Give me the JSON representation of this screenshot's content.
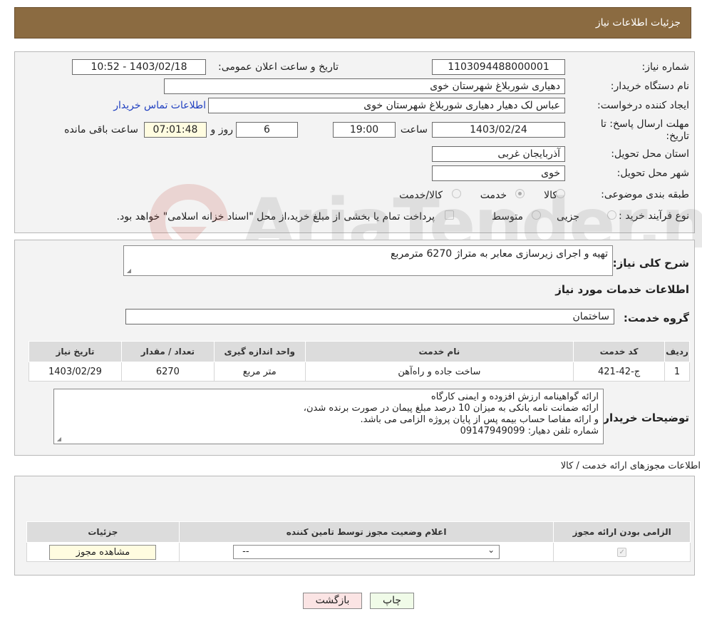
{
  "header": {
    "title": "جزئیات اطلاعات نیاز"
  },
  "info": {
    "need_number_label": "شماره نیاز:",
    "need_number": "1103094488000001",
    "announce_label": "تاریخ و ساعت اعلان عمومی:",
    "announce_value": "1403/02/18 - 10:52",
    "buyer_label": "نام دستگاه خریدار:",
    "buyer_value": "دهیاری شوربلاغ شهرستان خوی",
    "creator_label": "ایجاد کننده درخواست:",
    "creator_value": "عباس لک دهیار دهیاری شوربلاغ شهرستان خوی",
    "contact_link": "اطلاعات تماس خریدار",
    "deadline_label_1": "مهلت ارسال پاسخ: تا",
    "deadline_label_2": "تاریخ:",
    "deadline_date": "1403/02/24",
    "time_label": "ساعت",
    "deadline_time": "19:00",
    "days_value": "6",
    "days_label": "روز و",
    "remaining_time": "07:01:48",
    "remaining_label": "ساعت باقی مانده",
    "province_label": "استان محل تحویل:",
    "province_value": "آذربایجان غربی",
    "city_label": "شهر محل تحویل:",
    "city_value": "خوی",
    "category_label": "طبقه بندی موضوعی:",
    "category_options": [
      "کالا",
      "خدمت",
      "کالا/خدمت"
    ],
    "purchase_label": "نوع فرآیند خرید :",
    "purchase_options": [
      "جزیی",
      "متوسط"
    ],
    "payment_note": "پرداخت تمام یا بخشی از مبلغ خرید،از محل \"اسناد خزانه اسلامی\" خواهد بود."
  },
  "summary": {
    "desc_label": "شرح کلی نیاز:",
    "desc_value": "تهیه و اجرای زیرسازی معابر به متراژ 6270 مترمربع",
    "services_title": "اطلاعات خدمات مورد نیاز",
    "group_label": "گروه خدمت:",
    "group_value": "ساختمان",
    "table_headers": [
      "ردیف",
      "کد خدمت",
      "نام خدمت",
      "واحد اندازه گیری",
      "تعداد / مقدار",
      "تاریخ نیاز"
    ],
    "table_rows": [
      [
        "1",
        "ج-42-421",
        "ساخت جاده و راه‌آهن",
        "متر مربع",
        "6270",
        "1403/02/29"
      ]
    ],
    "buyer_notes_label": "توضیحات خریدار:",
    "buyer_notes": [
      "ارائه گواهینامه ارزش افزوده و ایمنی کارگاه",
      "ارائه ضمانت نامه بانکی به میزان 10 درصد مبلغ پیمان در صورت برنده شدن،",
      "و ارائه مفاصا حساب بیمه پس از پایان پروژه الزامی می باشد.",
      "شماره تلفن دهیار: 09147949099"
    ]
  },
  "permits": {
    "section_title": "اطلاعات مجوزهای ارائه خدمت / کالا",
    "headers": [
      "الزامی بودن ارائه مجوز",
      "اعلام وضعیت مجوز توسط تامین کننده",
      "جزئیات"
    ],
    "status_select": "--",
    "view_button": "مشاهده مجوز"
  },
  "actions": {
    "print": "چاپ",
    "back": "بازگشت"
  },
  "watermark": {
    "text": "AriaTender.neT"
  },
  "colors": {
    "header_bg": "#8b6b41",
    "link": "#2040c0",
    "back_button": "#fbe4e4",
    "print_button": "#f0fbe8"
  }
}
